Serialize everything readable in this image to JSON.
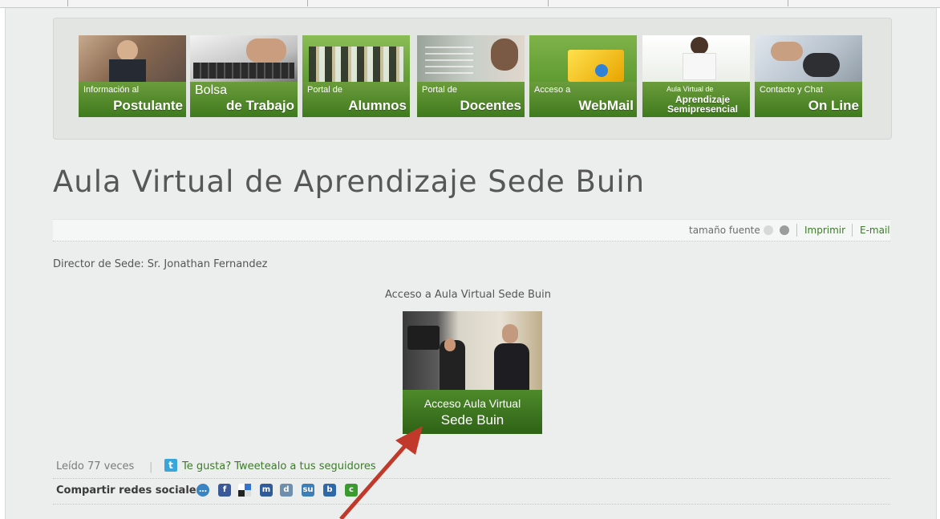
{
  "nav_tiles": [
    {
      "small": "Información al",
      "big": "Postulante"
    },
    {
      "small": "Bolsa",
      "big": "de Trabajo"
    },
    {
      "small": "Portal de",
      "big": "Alumnos"
    },
    {
      "small": "Portal de",
      "big": "Docentes"
    },
    {
      "small": "Acceso a",
      "big": "WebMail"
    },
    {
      "small": "Aula Virtual de",
      "big": "Aprendizaje Semipresencial"
    },
    {
      "small": "Contacto y Chat",
      "big": "On Line"
    }
  ],
  "article": {
    "title": "Aula Virtual de Aprendizaje Sede Buin",
    "director": "Director de Sede: Sr. Jonathan Fernandez",
    "caption": "Acceso a Aula Virtual Sede Buin",
    "promo_line1": "Acceso Aula Virtual",
    "promo_line2": "Sede Buin"
  },
  "toolbar": {
    "font_size_label": "tamaño fuente",
    "print_label": "Imprimir",
    "email_label": "E-mail"
  },
  "footer": {
    "read_count": "Leído 77 veces",
    "separator": "|",
    "tweet_text": "Te gusta? Tweetealo a tus seguidores",
    "share_label": "Compartir redes sociales"
  },
  "social_icons": [
    "chat-bubble-icon",
    "facebook-icon",
    "delicious-icon",
    "myspace-icon",
    "digg-icon",
    "stumbleupon-icon",
    "blogger-icon",
    "technorati-icon"
  ],
  "colors": {
    "brand_green": "#3f7a1e",
    "link_green": "#3d7a2a",
    "arrow_red": "#c0392b"
  }
}
